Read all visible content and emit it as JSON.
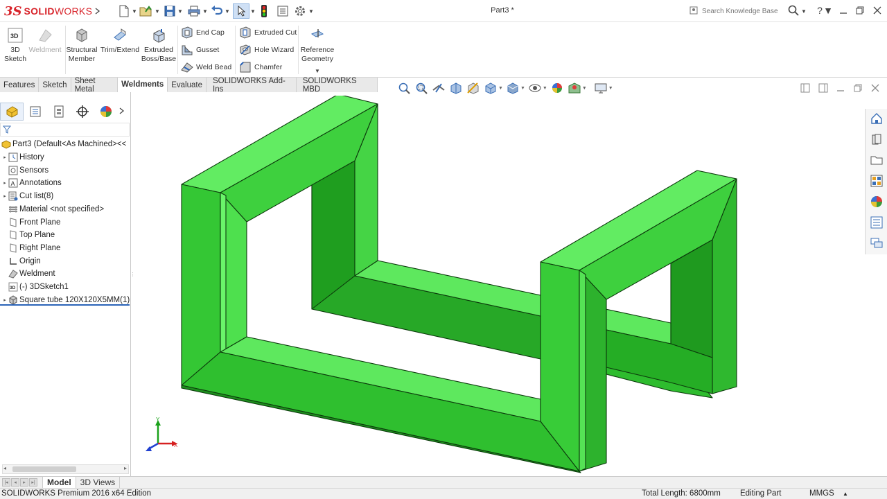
{
  "app": {
    "logo_ds": "3S",
    "logo_solid": "SOLID",
    "logo_works": "WORKS",
    "document_title": "Part3 *"
  },
  "search": {
    "placeholder": "Search Knowledge Base"
  },
  "command_manager": {
    "big_buttons": [
      {
        "label_1": "3D",
        "label_2": "Sketch",
        "icon": "3d-sketch-icon"
      },
      {
        "label_1": "Weldment",
        "label_2": "",
        "icon": "weldment-icon",
        "disabled": true
      },
      {
        "label_1": "Structural",
        "label_2": "Member",
        "icon": "structural-member-icon"
      },
      {
        "label_1": "Trim/Extend",
        "label_2": "",
        "icon": "trim-extend-icon"
      },
      {
        "label_1": "Extruded",
        "label_2": "Boss/Base",
        "icon": "extruded-boss-icon"
      }
    ],
    "small_buttons": [
      {
        "label": "End Cap",
        "icon": "end-cap-icon"
      },
      {
        "label": "Gusset",
        "icon": "gusset-icon"
      },
      {
        "label": "Weld Bead",
        "icon": "weld-bead-icon"
      },
      {
        "label": "Extruded Cut",
        "icon": "extruded-cut-icon"
      },
      {
        "label": "Hole Wizard",
        "icon": "hole-wizard-icon"
      },
      {
        "label": "Chamfer",
        "icon": "chamfer-icon"
      }
    ],
    "reference_geometry": {
      "label_1": "Reference",
      "label_2": "Geometry"
    }
  },
  "tabs": [
    {
      "label": "Features"
    },
    {
      "label": "Sketch"
    },
    {
      "label": "Sheet Metal"
    },
    {
      "label": "Weldments",
      "active": true
    },
    {
      "label": "Evaluate"
    },
    {
      "label": "SOLIDWORKS Add-Ins"
    },
    {
      "label": "SOLIDWORKS MBD"
    }
  ],
  "feature_tree": {
    "root": "Part3  (Default<As Machined><<",
    "items": [
      {
        "label": "History",
        "icon": "history-icon",
        "expandable": true
      },
      {
        "label": "Sensors",
        "icon": "sensors-icon",
        "expandable": false
      },
      {
        "label": "Annotations",
        "icon": "annotations-icon",
        "expandable": true
      },
      {
        "label": "Cut list(8)",
        "icon": "cut-list-icon",
        "expandable": true
      },
      {
        "label": "Material <not specified>",
        "icon": "material-icon",
        "expandable": false
      },
      {
        "label": "Front Plane",
        "icon": "plane-icon",
        "expandable": false
      },
      {
        "label": "Top Plane",
        "icon": "plane-icon",
        "expandable": false
      },
      {
        "label": "Right Plane",
        "icon": "plane-icon",
        "expandable": false
      },
      {
        "label": "Origin",
        "icon": "origin-icon",
        "expandable": false
      },
      {
        "label": "Weldment",
        "icon": "weldment-icon",
        "expandable": false
      },
      {
        "label": "(-) 3DSketch1",
        "icon": "3d-sketch-icon",
        "expandable": false
      },
      {
        "label": "Square tube 120X120X5MM(1)",
        "icon": "structural-member-icon",
        "expandable": true
      }
    ]
  },
  "bottom_tabs": [
    {
      "label": "Model",
      "active": true
    },
    {
      "label": "3D Views"
    }
  ],
  "status_bar": {
    "edition": "SOLIDWORKS Premium 2016 x64 Edition",
    "total_length": "Total Length: 6800mm",
    "mode": "Editing Part",
    "units": "MMGS"
  },
  "triad": {
    "y_label": "Y",
    "x_label": "X"
  },
  "colors": {
    "model_green": "#3cd43c",
    "brand_red": "#d8232a",
    "accent_blue": "#2a63b8"
  }
}
